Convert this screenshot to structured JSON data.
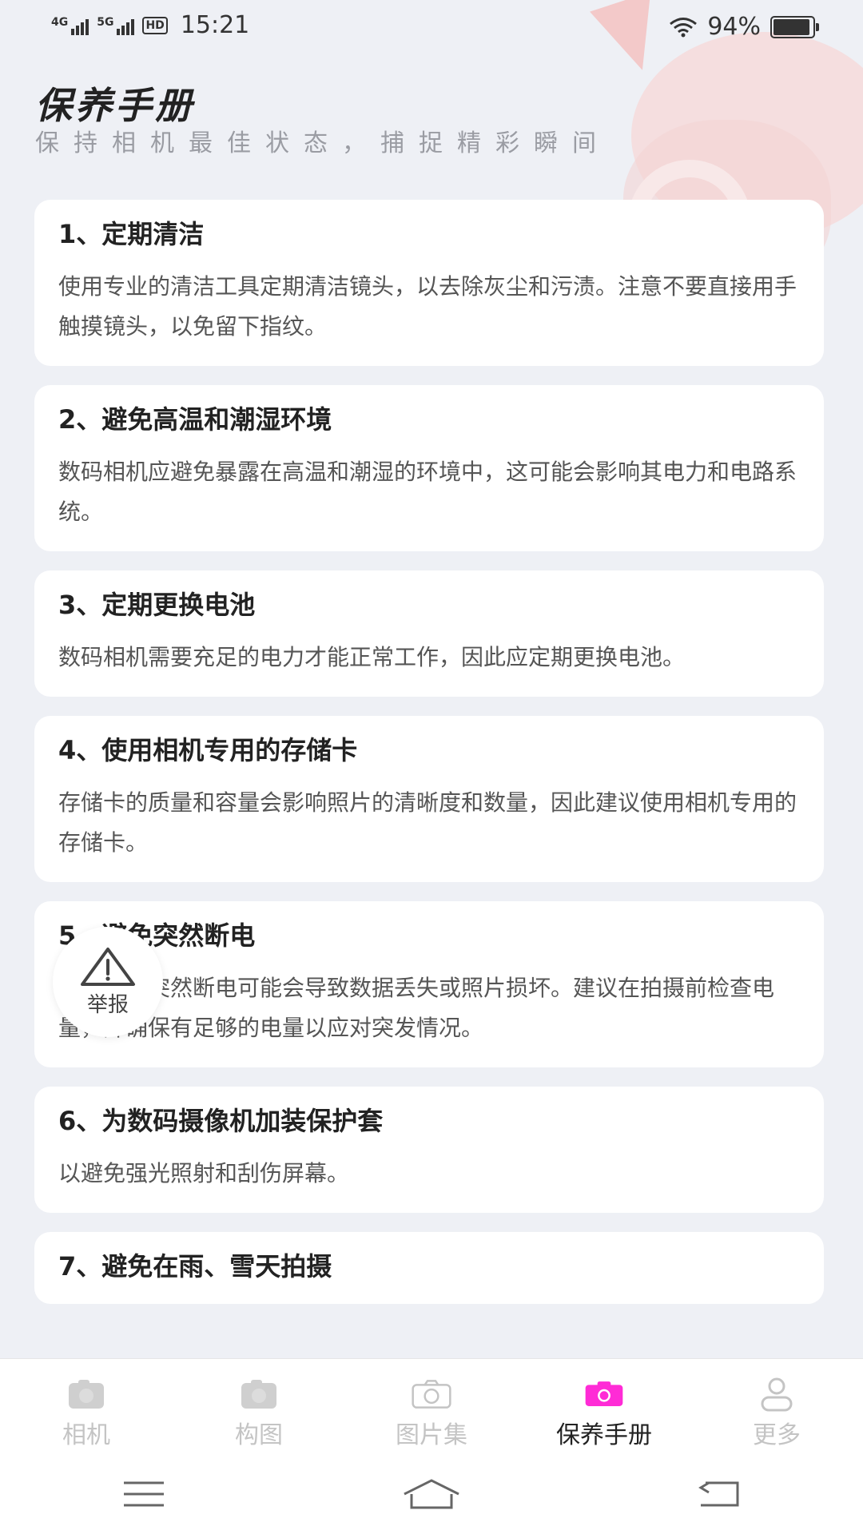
{
  "status": {
    "net1": "4G",
    "net2": "5G",
    "hd": "HD",
    "time": "15:21",
    "battery": "94%",
    "battery_level": 0.94
  },
  "header": {
    "title": "保养手册",
    "subtitle": "保持相机最佳状态，捕捉精彩瞬间"
  },
  "cards": [
    {
      "title": "1、定期清洁",
      "body": "使用专业的清洁工具定期清洁镜头，以去除灰尘和污渍。注意不要直接用手触摸镜头，以免留下指纹。"
    },
    {
      "title": "2、避免高温和潮湿环境",
      "body": "数码相机应避免暴露在高温和潮湿的环境中，这可能会影响其电力和电路系统。"
    },
    {
      "title": "3、定期更换电池",
      "body": "数码相机需要充足的电力才能正常工作，因此应定期更换电池。"
    },
    {
      "title": "4、使用相机专用的存储卡",
      "body": "存储卡的质量和容量会影响照片的清晰度和数量，因此建议使用相机专用的存储卡。"
    },
    {
      "title": "5、避免突然断电",
      "body": "在拍摄时突然断电可能会导致数据丢失或照片损坏。建议在拍摄前检查电量，并确保有足够的电量以应对突发情况。"
    },
    {
      "title": "6、为数码摄像机加装保护套",
      "body": "以避免强光照射和刮伤屏幕。"
    },
    {
      "title": "7、避免在雨、雪天拍摄",
      "body": ""
    }
  ],
  "report": {
    "label": "举报"
  },
  "tabs": [
    {
      "label": "相机",
      "icon": "camera-fill-icon",
      "active": false
    },
    {
      "label": "构图",
      "icon": "image-fill-icon",
      "active": false
    },
    {
      "label": "图片集",
      "icon": "camera-outline-icon",
      "active": false
    },
    {
      "label": "保养手册",
      "icon": "camera-icon",
      "active": true
    },
    {
      "label": "更多",
      "icon": "user-icon",
      "active": false
    }
  ],
  "colors": {
    "accent": "#ff2bd6",
    "inactive": "#c4c4c4",
    "background": "#eef0f5"
  }
}
